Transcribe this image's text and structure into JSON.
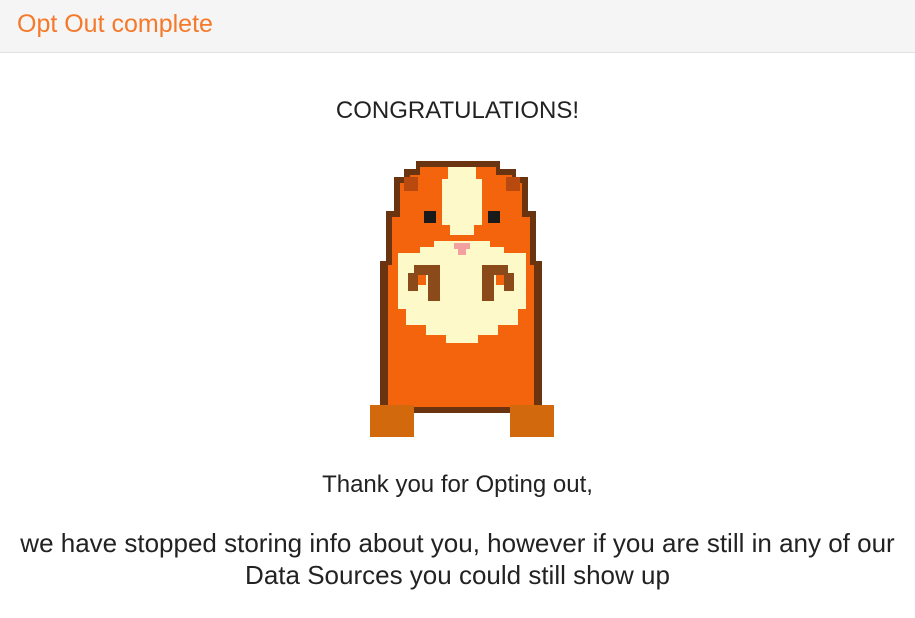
{
  "header": {
    "title": "Opt Out complete"
  },
  "main": {
    "heading": "CONGRATULATIONS!",
    "mascot_icon": "guinea-pig-pixel-icon",
    "thanks": "Thank you for Opting out,",
    "detail": "we have stopped storing info about you, however if you are still in any of our Data Sources you could still show up"
  },
  "colors": {
    "accent": "#f5792a",
    "header_bg": "#f5f5f5",
    "text": "#222222",
    "mascot_orange": "#f4640c",
    "mascot_cream": "#fdf9c8",
    "mascot_outline": "#6b3410",
    "mascot_feet": "#d2690c"
  }
}
